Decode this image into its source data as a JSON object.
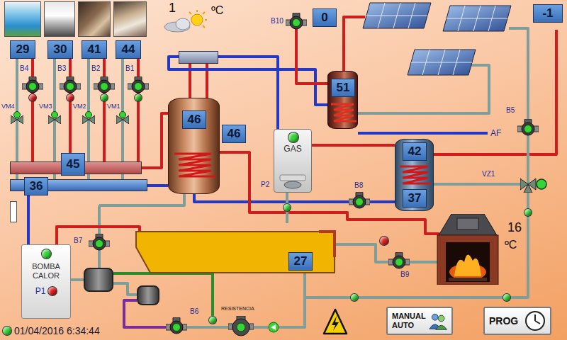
{
  "rooms": [
    {
      "reading": "29"
    },
    {
      "reading": "30"
    },
    {
      "reading": "41"
    },
    {
      "reading": "44"
    }
  ],
  "room_pumps": [
    {
      "label": "B4",
      "on": true,
      "status_color": "#e02020"
    },
    {
      "label": "B3",
      "on": true,
      "status_color": "#e02020"
    },
    {
      "label": "B2",
      "on": true,
      "status_color": "#22c022"
    },
    {
      "label": "B1",
      "on": true,
      "status_color": "#22c022"
    }
  ],
  "mixing_valves": [
    {
      "label": "VM4",
      "on": true
    },
    {
      "label": "VM3",
      "on": true
    },
    {
      "label": "VM2",
      "on": true
    },
    {
      "label": "VM1",
      "on": true
    }
  ],
  "manifolds": [
    {
      "reading": "45"
    },
    {
      "reading": "36"
    }
  ],
  "outdoor": {
    "reading": "1",
    "unit": "ºC"
  },
  "collector": {
    "reading": "-1"
  },
  "solar_valve": {
    "label": "B10",
    "on": true,
    "reading": "0"
  },
  "main_tank": {
    "top_reading": "46",
    "side_reading": "46"
  },
  "solar_tank": {
    "reading": "51"
  },
  "dhw_tank": {
    "top_reading": "42",
    "bottom_reading": "37"
  },
  "boiler": {
    "label": "GAS",
    "pump_label": "P2",
    "on": true
  },
  "pumps": [
    {
      "label": "B5",
      "on": true
    },
    {
      "label": "B8",
      "on": true
    },
    {
      "label": "B7",
      "on": true
    },
    {
      "label": "B9",
      "on": true,
      "status_color": "#e02020"
    },
    {
      "label": "B6",
      "on": true
    }
  ],
  "zone_valve": {
    "label": "VZ1",
    "on": true
  },
  "cold_water": {
    "label": "AF"
  },
  "fireplace": {
    "reading": "16",
    "unit": "ºC"
  },
  "buffer": {
    "reading": "27"
  },
  "heat_pump": {
    "label": "BOMBA CALOR",
    "on": true,
    "pump_label": "P1",
    "pump_on": false
  },
  "resistance": {
    "label": "RESISTENCIA",
    "on": true
  },
  "sensors": [
    {
      "on": true
    },
    {
      "on": true
    },
    {
      "on": true
    },
    {
      "on": true
    },
    {
      "on": true
    }
  ],
  "buttons": [
    {
      "label": "MANUAL",
      "sublabel": "AUTO"
    },
    {
      "label": "PROG"
    }
  ],
  "status_bar": {
    "online": true,
    "datetime": "01/04/2016 6:34:44"
  }
}
